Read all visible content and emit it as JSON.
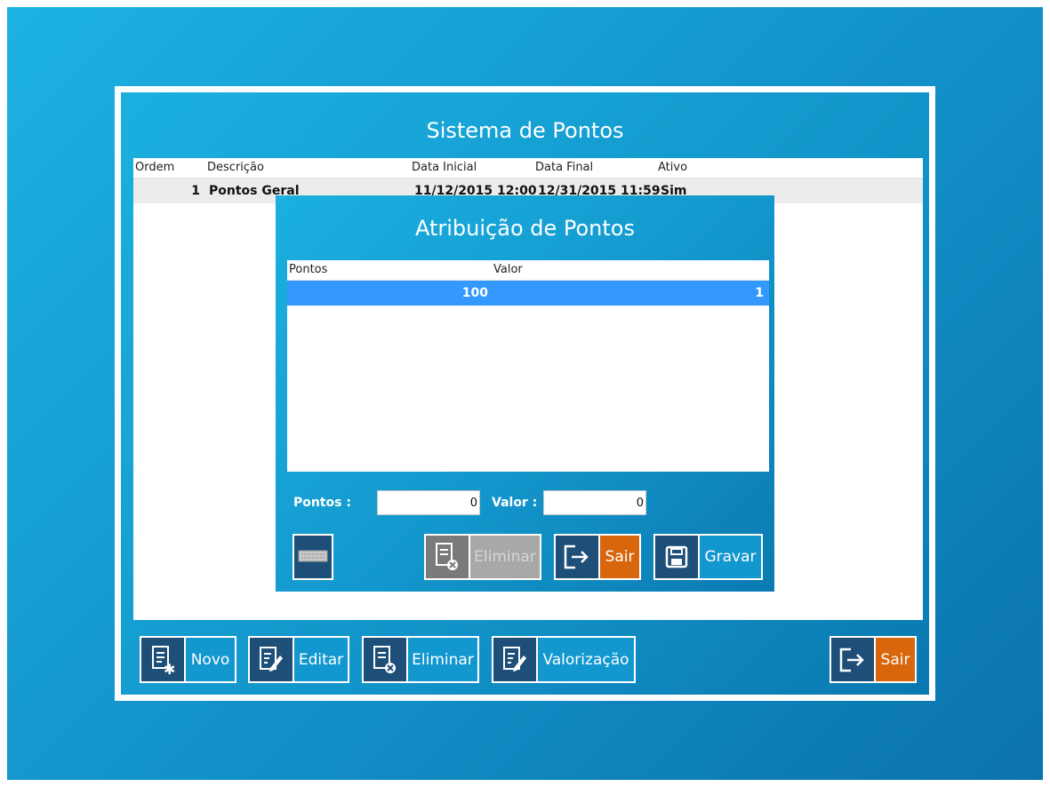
{
  "main": {
    "title": "Sistema de Pontos",
    "columns": [
      "Ordem",
      "Descrição",
      "Data Inicial",
      "Data Final",
      "Ativo"
    ],
    "row": {
      "ordem": "1",
      "descricao": "Pontos Geral",
      "data_inicial": "11/12/2015 12:00",
      "data_final": "12/31/2015 11:59",
      "ativo": "Sim"
    },
    "buttons": {
      "novo": "Novo",
      "editar": "Editar",
      "eliminar": "Eliminar",
      "valorizacao": "Valorização",
      "sair": "Sair"
    }
  },
  "dialog": {
    "title": "Atribuição de Pontos",
    "columns": [
      "Pontos",
      "Valor"
    ],
    "rows": [
      {
        "pontos": "100",
        "valor": "1"
      }
    ],
    "fields": {
      "pontos_label": "Pontos :",
      "pontos_value": "0",
      "valor_label": "Valor :",
      "valor_value": "0"
    },
    "buttons": {
      "eliminar": "Eliminar",
      "sair": "Sair",
      "gravar": "Gravar"
    }
  },
  "icons": {
    "new": "document-new-icon",
    "edit": "document-edit-icon",
    "delete": "document-delete-icon",
    "valorize": "document-edit-icon",
    "exit": "exit-icon",
    "save": "floppy-disk-icon",
    "keyboard": "keyboard-icon"
  },
  "colors": {
    "background": "#1290c8",
    "icon_panel": "#1e4f78",
    "label_panel": "#1297cf",
    "exit_orange": "#d8660c",
    "selected_row": "#3399ff"
  }
}
